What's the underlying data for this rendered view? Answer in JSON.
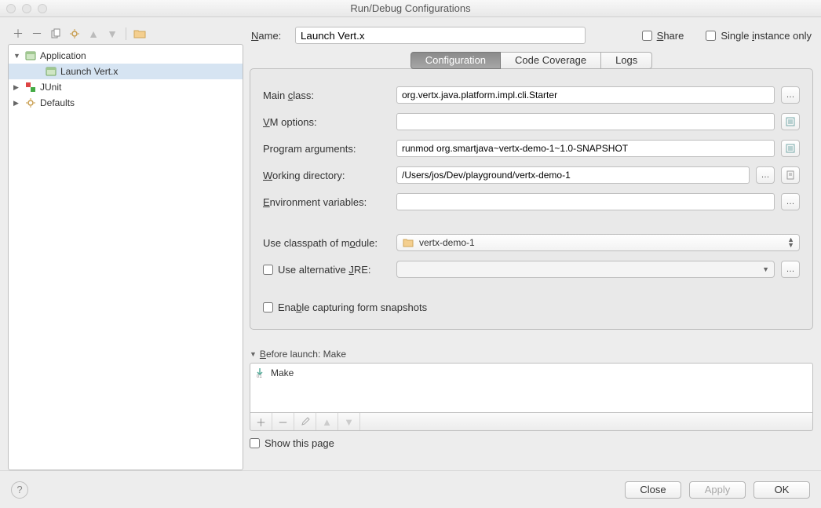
{
  "title": "Run/Debug Configurations",
  "sidebar": {
    "items": [
      {
        "label": "Application",
        "kind": "folder",
        "expanded": true,
        "depth": 0
      },
      {
        "label": "Launch Vert.x",
        "kind": "config",
        "selected": true,
        "depth": 1
      },
      {
        "label": "JUnit",
        "kind": "junit",
        "expanded": false,
        "depth": 0
      },
      {
        "label": "Defaults",
        "kind": "defaults",
        "expanded": false,
        "depth": 0
      }
    ]
  },
  "name": {
    "label": "Name:",
    "value": "Launch Vert.x"
  },
  "share": {
    "label": "Share",
    "checked": false
  },
  "single_instance": {
    "label": "Single instance only",
    "checked": false
  },
  "tabs": [
    {
      "label": "Configuration",
      "active": true
    },
    {
      "label": "Code Coverage",
      "active": false
    },
    {
      "label": "Logs",
      "active": false
    }
  ],
  "config": {
    "main_class": {
      "label": "Main class:",
      "value": "org.vertx.java.platform.impl.cli.Starter"
    },
    "vm_options": {
      "label": "VM options:",
      "value": ""
    },
    "program_args": {
      "label": "Program arguments:",
      "value": "runmod org.smartjava~vertx-demo-1~1.0-SNAPSHOT"
    },
    "working_dir": {
      "label": "Working directory:",
      "value": "/Users/jos/Dev/playground/vertx-demo-1"
    },
    "env_vars": {
      "label": "Environment variables:",
      "value": ""
    },
    "classpath_module": {
      "label": "Use classpath of module:",
      "value": "vertx-demo-1"
    },
    "alt_jre": {
      "label": "Use alternative JRE:",
      "checked": false,
      "value": ""
    },
    "enable_snapshots": {
      "label": "Enable capturing form snapshots",
      "checked": false
    }
  },
  "before_launch": {
    "header": "Before launch: Make",
    "items": [
      {
        "label": "Make"
      }
    ],
    "show_page": {
      "label": "Show this page",
      "checked": false
    }
  },
  "buttons": {
    "close": "Close",
    "apply": "Apply",
    "ok": "OK"
  }
}
